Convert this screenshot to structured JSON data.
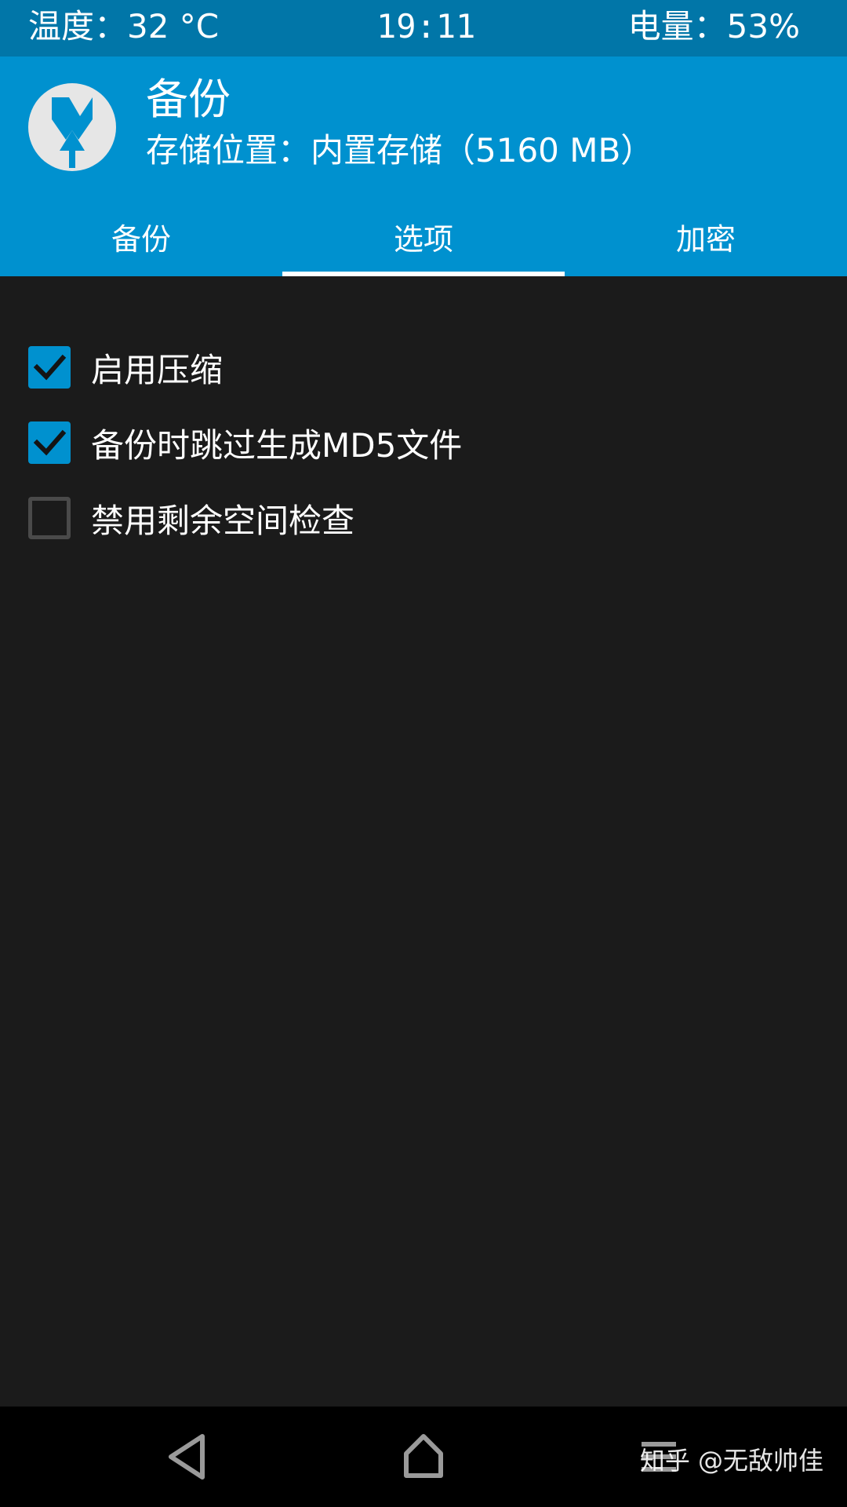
{
  "status_bar": {
    "temperature": "温度：32 °C",
    "time": "19:11",
    "battery": "电量：53%"
  },
  "header": {
    "logo_icon": "twrp-logo-icon",
    "title": "备份",
    "subtitle": "存储位置：内置存储（5160 MB）"
  },
  "tabs": [
    {
      "label": "备份",
      "active": false
    },
    {
      "label": "选项",
      "active": true
    },
    {
      "label": "加密",
      "active": false
    }
  ],
  "options": [
    {
      "label": "启用压缩",
      "checked": true
    },
    {
      "label": "备份时跳过生成MD5文件",
      "checked": true
    },
    {
      "label": "禁用剩余空间检查",
      "checked": false
    }
  ],
  "nav_bar": {
    "back_icon": "back-triangle-icon",
    "home_icon": "home-icon",
    "menu_icon": "menu-lines-icon",
    "watermark": "知乎 @无敌帅佳"
  },
  "colors": {
    "status_bar": "#0176a8",
    "header": "#0091cf",
    "background": "#1b1b1b",
    "accent": "#0091cf"
  }
}
